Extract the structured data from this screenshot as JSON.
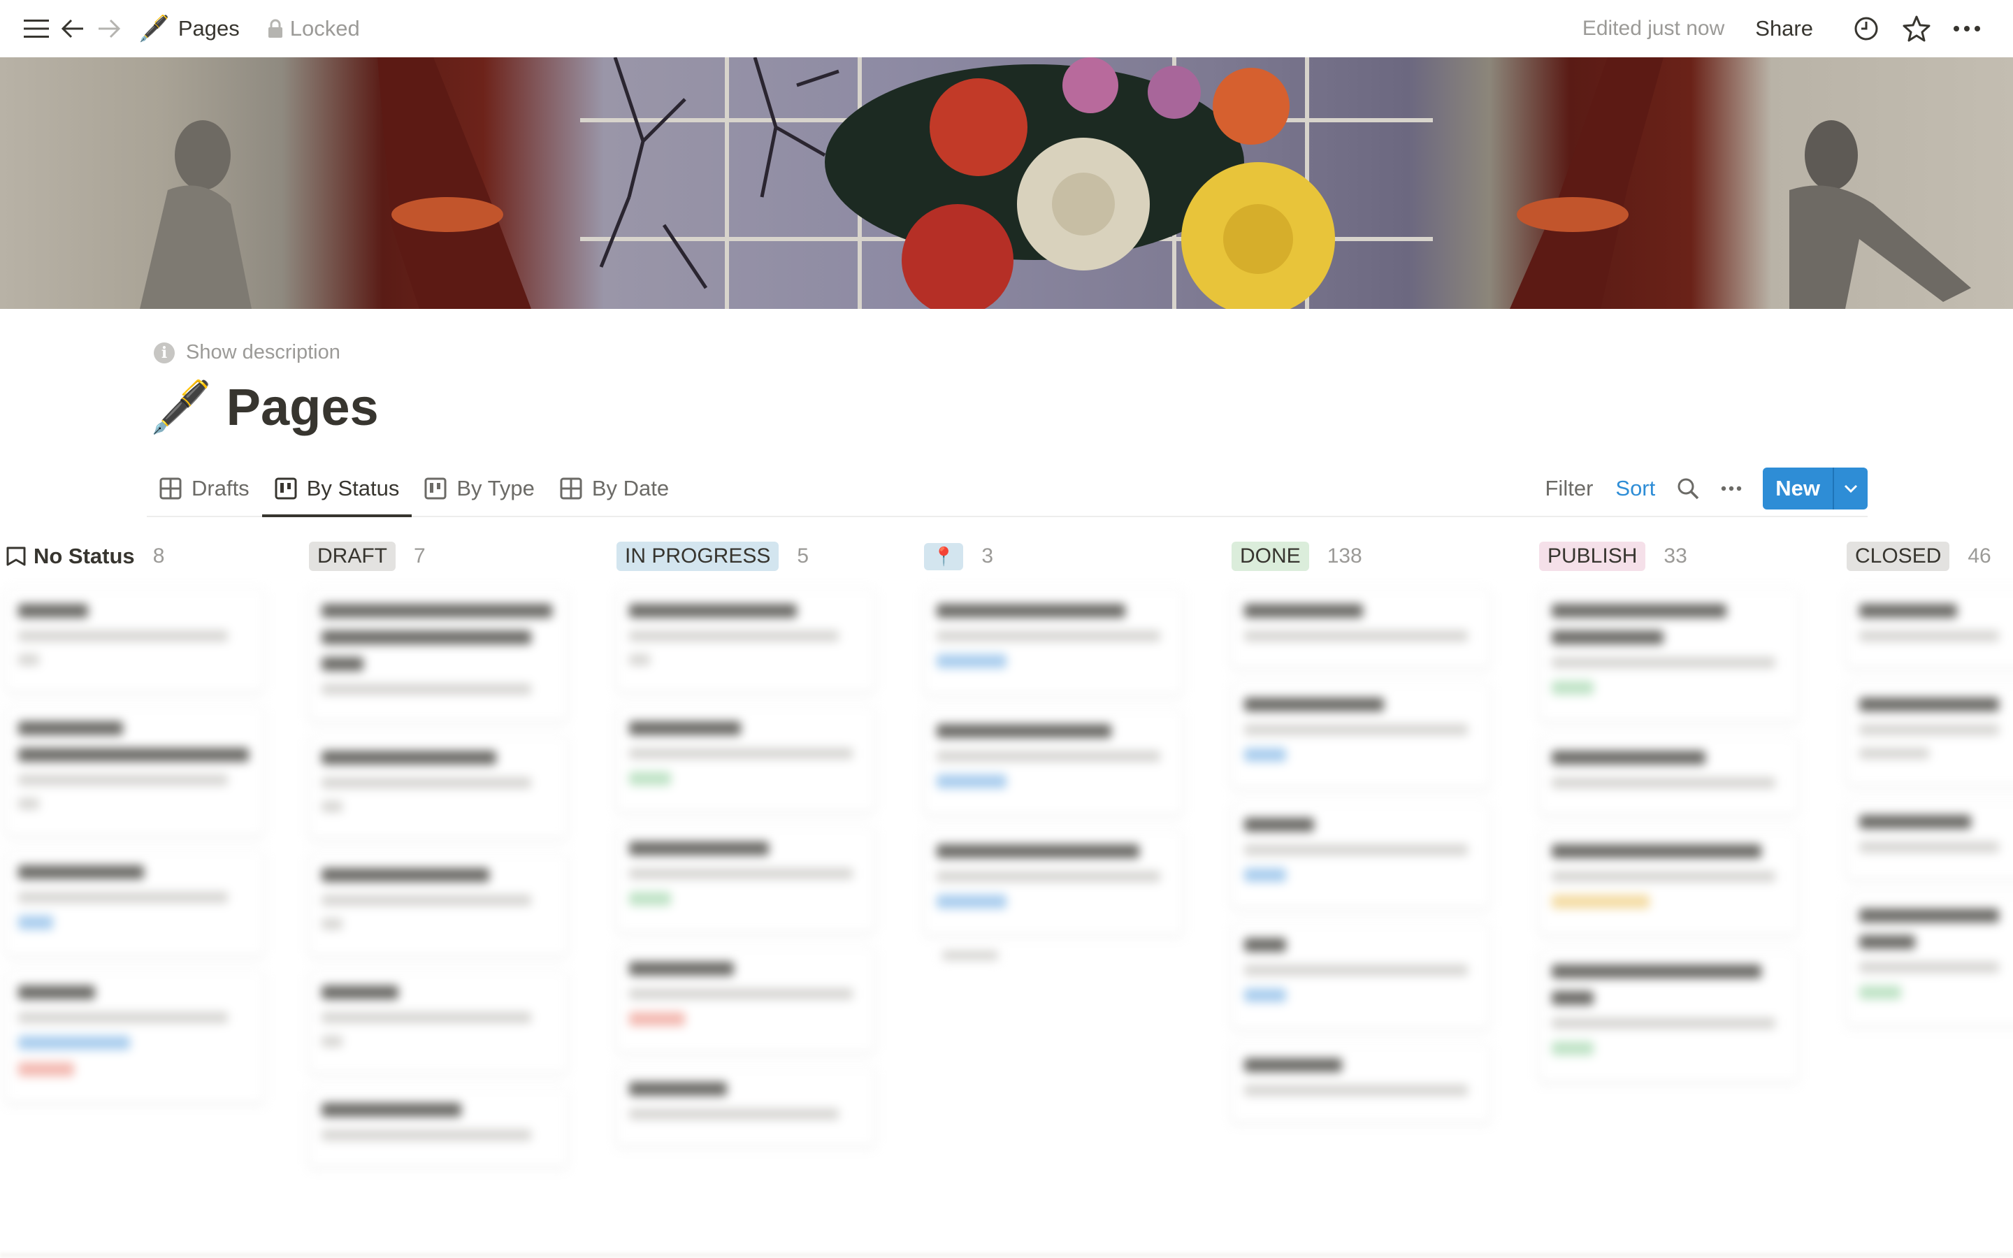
{
  "topbar": {
    "breadcrumb_emoji": "🖋️",
    "breadcrumb_title": "Pages",
    "locked_label": "Locked",
    "edited_label": "Edited just now",
    "share_label": "Share"
  },
  "page": {
    "show_description": "Show description",
    "emoji": "🖋️",
    "title": "Pages"
  },
  "views": {
    "tabs": [
      {
        "label": "Drafts",
        "icon": "table-icon"
      },
      {
        "label": "By Status",
        "icon": "board-icon",
        "active": true
      },
      {
        "label": "By Type",
        "icon": "board-icon"
      },
      {
        "label": "By Date",
        "icon": "table-icon"
      }
    ],
    "filter_label": "Filter",
    "sort_label": "Sort",
    "new_label": "New"
  },
  "board": {
    "columns": [
      {
        "label": "No Status",
        "count": "8"
      },
      {
        "label": "DRAFT",
        "count": "7",
        "color": "#e3e2e0"
      },
      {
        "label": "IN PROGRESS",
        "count": "5",
        "color": "#d3e5ef"
      },
      {
        "label": "📍",
        "count": "3",
        "color": "#d3e5ef"
      },
      {
        "label": "DONE",
        "count": "138",
        "color": "#dbeddb"
      },
      {
        "label": "PUBLISH",
        "count": "33",
        "color": "#f5e0e9"
      },
      {
        "label": "CLOSED",
        "count": "46",
        "color": "#e3e2e0"
      }
    ]
  },
  "colors": {
    "accent": "#2e8dd6",
    "text": "#37352f",
    "muted": "#9b9a97"
  }
}
